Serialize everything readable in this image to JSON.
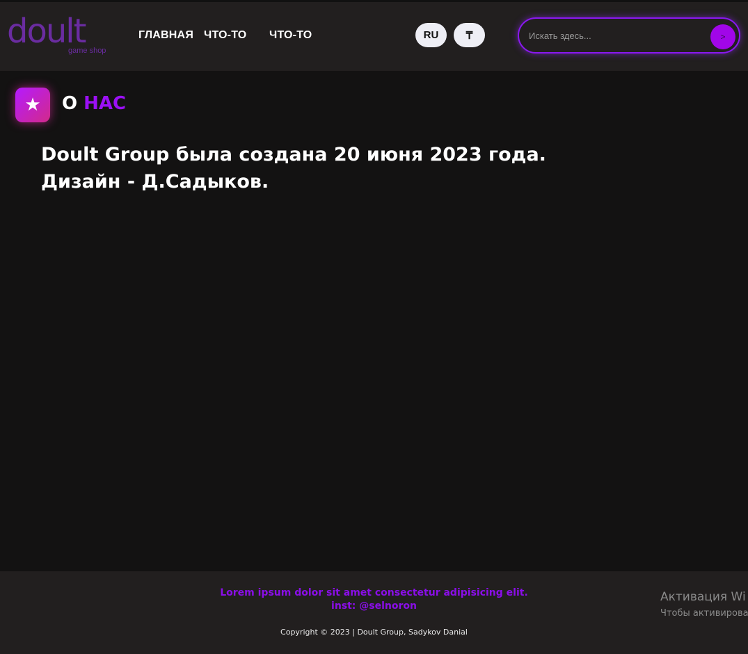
{
  "header": {
    "logo_text": "doult",
    "logo_subtitle": "game shop",
    "nav": [
      "ГЛАВНАЯ",
      "ЧТО-ТО",
      "ЧТО-ТО"
    ],
    "language": "RU",
    "currency": "₸",
    "search_placeholder": "Искать здесь...",
    "search_button": ">"
  },
  "section": {
    "title_white": "О",
    "title_accent": "НАС",
    "icon": "star-icon"
  },
  "about": {
    "line1": "Doult Group была создана 20 июня 2023 года.",
    "line2": "Дизайн - Д.Садыков."
  },
  "footer": {
    "lorem": "Lorem ipsum dolor sit amet consectetur adipisicing elit.",
    "inst": "inst: @selnoron",
    "copyright": "Copyright © 2023 | Doult Group, Sadykov Danial"
  },
  "watermark": {
    "title": "Активация Wi",
    "subtitle": "Чтобы активирова"
  },
  "colors": {
    "accent": "#9b10f5",
    "background": "#131212",
    "header_bg": "#221f1f"
  }
}
